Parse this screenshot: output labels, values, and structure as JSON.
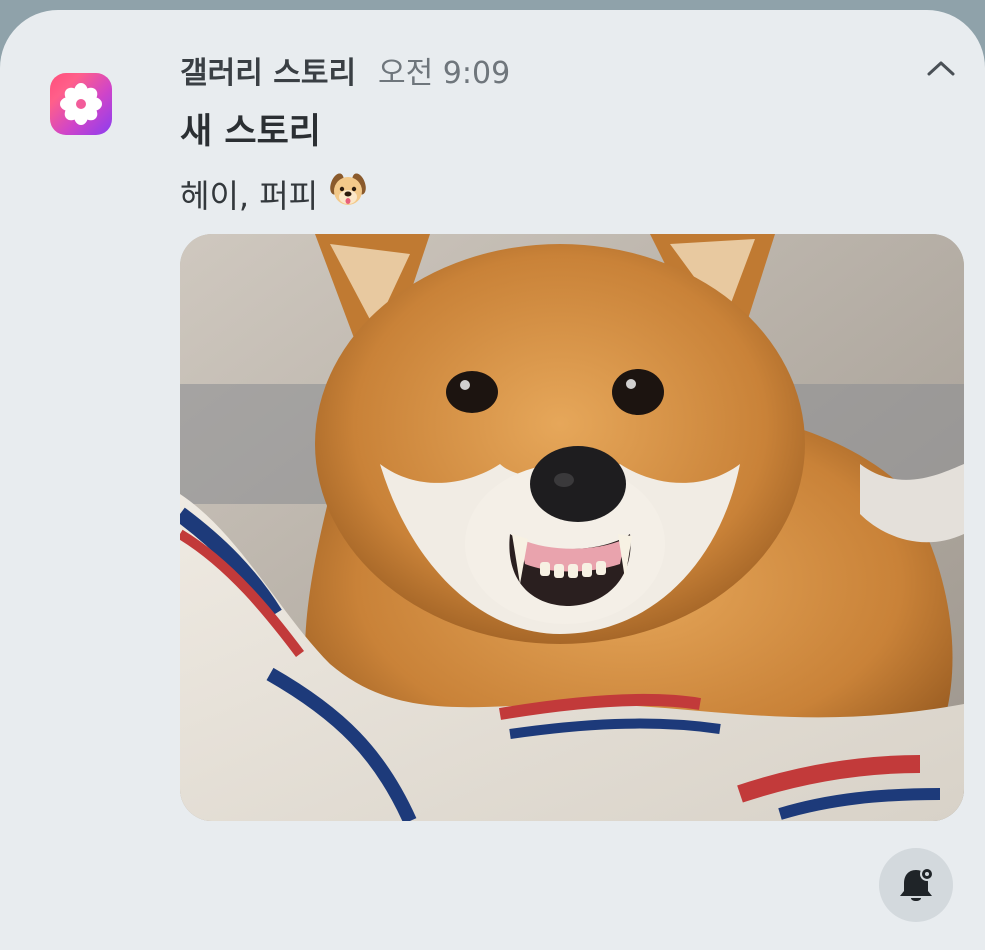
{
  "notification": {
    "app_name": "갤러리 스토리",
    "time": "오전 9:09",
    "title": "새 스토리",
    "message": "헤이, 퍼피",
    "message_emoji_icon": "dog-face-icon",
    "app_icon": "flower-icon",
    "collapse_icon": "chevron-up-icon",
    "settings_icon": "bell-settings-icon",
    "image_alt": "shiba-inu-photo"
  },
  "colors": {
    "app_icon_gradient": [
      "#ff4f7b",
      "#d045c8",
      "#8b3df0"
    ],
    "card_background": "#e8ecef",
    "title_text": "#2b2f33",
    "secondary_text": "#6f767c"
  }
}
